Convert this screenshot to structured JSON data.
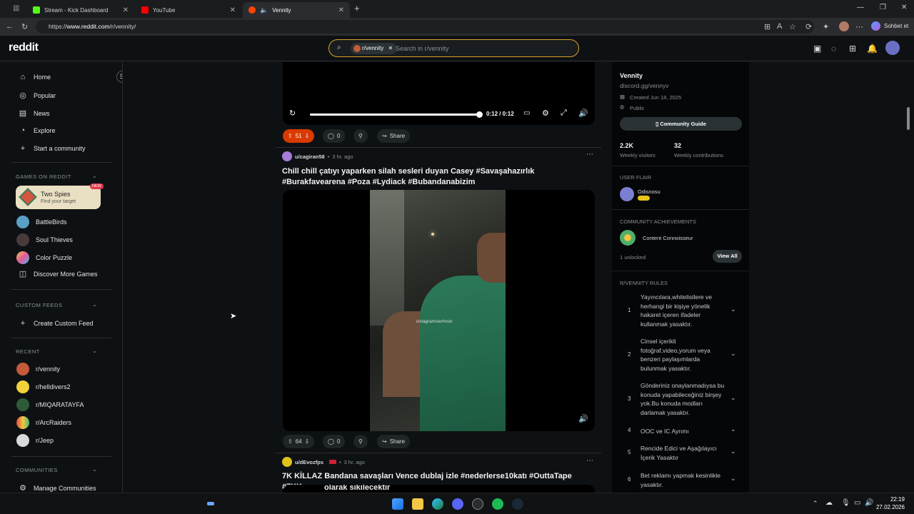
{
  "browser": {
    "tabs": [
      {
        "label": "Stream - Kick Dashboard",
        "color": "#53fc18"
      },
      {
        "label": "YouTube",
        "color": "#ff0000"
      },
      {
        "label": "Vennity",
        "color": "#ff4500"
      }
    ],
    "url_prefix": "https://",
    "url_host": "www.reddit.com",
    "url_path": "/r/vennity/",
    "chat_label": "Sohbet et"
  },
  "header": {
    "logo": "reddit",
    "search_chip": "r/vennity",
    "search_placeholder": "Search in r/vennity"
  },
  "sidebar": {
    "nav": [
      {
        "label": "Home",
        "icon": "home-icon"
      },
      {
        "label": "Popular",
        "icon": "popular-icon"
      },
      {
        "label": "News",
        "icon": "news-icon"
      },
      {
        "label": "Explore",
        "icon": "explore-icon"
      },
      {
        "label": "Start a community",
        "icon": "plus-icon"
      }
    ],
    "games_header": "GAMES ON REDDIT",
    "featured_game": {
      "title": "Two Spies",
      "subtitle": "Find your target",
      "badge": "NEW"
    },
    "games": [
      "BattleBirds",
      "Soul Thieves",
      "Color Puzzle",
      "Discover More Games"
    ],
    "custom_feeds_header": "CUSTOM FEEDS",
    "create_custom_feed": "Create Custom Feed",
    "recent_header": "RECENT",
    "recent": [
      "r/vennity",
      "r/helldivers2",
      "r/MIQARATAYFA",
      "r/ArcRaiders",
      "r/Jeep"
    ],
    "communities_header": "COMMUNITIES",
    "manage_communities": "Manage Communities"
  },
  "feed": {
    "video1": {
      "time": "0:12 / 0:12",
      "progress": 1.0,
      "votes": "51",
      "comments": "0",
      "share": "Share"
    },
    "post2": {
      "user": "u/cagiran58",
      "age": "3 hr. ago",
      "title": "Chill chill çatıyı yaparken silah sesleri duyan Casey #Savaşahazırlık #Burakfavearena #Poza #Lydiack #Bubandanabizim",
      "watermark": "instagram/serhostv",
      "votes": "64",
      "comments": "0",
      "share": "Share"
    },
    "post3": {
      "user": "u/dEvozfps",
      "age": "3 hr. ago",
      "title": "7K KİLLAZ Bandana savaşları Vence dublaj izle #nederlerse10katı #OuttaTape #7KK",
      "caption": "olarak sikilecektir"
    }
  },
  "about": {
    "name": "Vennity",
    "link": "discord.gg/vennyv",
    "created": "Created Jun 18, 2025",
    "visibility": "Public",
    "guide_button": "Community Guide",
    "visitors_value": "2.2K",
    "visitors_label": "Weekly visitors",
    "contrib_value": "32",
    "contrib_label": "Weekly contributions",
    "flair_header": "USER FLAIR",
    "flair_user": "Odisnosu",
    "achievements_header": "COMMUNITY ACHIEVEMENTS",
    "achievement": "Content Connoisseur",
    "unlocked": "1 unlocked",
    "view_all": "View All",
    "rules_header": "R/VENNITY RULES",
    "rules": [
      {
        "n": "1",
        "text": "Yayıncılara,whitelistlere ve herhangi bir kişiye yönelik hakaret içeren ifadeler kullanmak yasaktır."
      },
      {
        "n": "2",
        "text": "Cinsel içerikli fotoğraf,video,yorum veya benzeri paylaşımlarda bulunmak yasaktır."
      },
      {
        "n": "3",
        "text": "Gönderiniz onaylanmadıysa bu konuda yapabileceğiniz birşey yok.Bu konuda modları darlamak yasaktır."
      },
      {
        "n": "4",
        "text": "OOC ve IC Ayrımı"
      },
      {
        "n": "5",
        "text": "Rencide Edici ve Aşağılayıcı İçerik Yasaktır"
      },
      {
        "n": "6",
        "text": "Bet reklamı yapmak kesinlikle yasaktır."
      }
    ]
  },
  "taskbar": {
    "time": "22:19",
    "date": "27.02.2026"
  }
}
